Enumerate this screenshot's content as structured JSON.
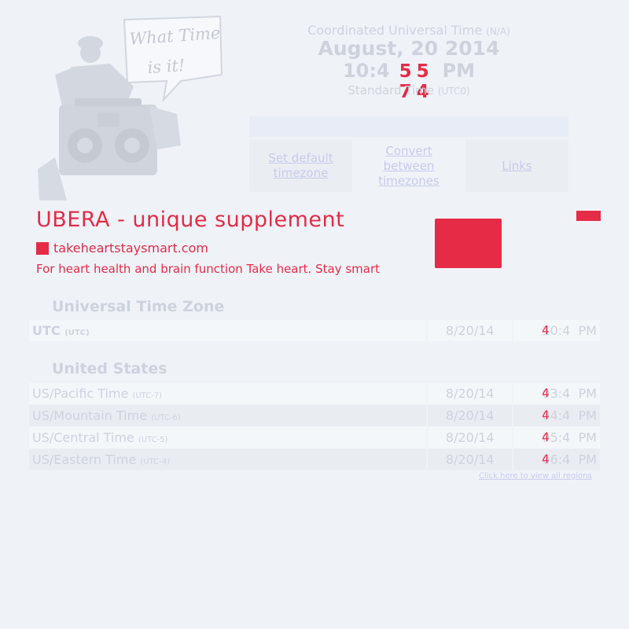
{
  "logo": {
    "speech_line1": "What Time",
    "speech_line2": "is it!"
  },
  "header": {
    "utc_label": "Coordinated Universal Time",
    "utc_tag": "(N/A)",
    "date": "August, 20 2014",
    "time_prefix": "10:4",
    "time_overlay": "5 5 7 4",
    "time_suffix": "PM",
    "std_label": "Standard Time",
    "std_tag": "(UTC0)"
  },
  "nav": {
    "set_default": "Set default timezone",
    "convert": "Convert between timezones",
    "links": "Links"
  },
  "ad": {
    "title": "UBERA - unique supplement",
    "url": "takeheartstaysmart.com",
    "desc": "For heart health and brain function Take heart. Stay smart"
  },
  "sections": {
    "utc_title": "Universal Time Zone",
    "us_title": "United States"
  },
  "rows": {
    "utc": {
      "name": "UTC",
      "tag": "(UTC)",
      "date": "8/20/14",
      "time": "10:4",
      "digit": "4",
      "ampm": "PM"
    },
    "pacific": {
      "name": "US/Pacific Time",
      "tag": "(UTC-7)",
      "date": "8/20/14",
      "time": "03:4",
      "digit": "4",
      "ampm": "PM"
    },
    "mountain": {
      "name": "US/Mountain Time",
      "tag": "(UTC-6)",
      "date": "8/20/14",
      "time": "04:4",
      "digit": "4",
      "ampm": "PM"
    },
    "central": {
      "name": "US/Central Time",
      "tag": "(UTC-5)",
      "date": "8/20/14",
      "time": "05:4",
      "digit": "4",
      "ampm": "PM"
    },
    "eastern": {
      "name": "US/Eastern Time",
      "tag": "(UTC-4)",
      "date": "8/20/14",
      "time": "06:4",
      "digit": "4",
      "ampm": "PM"
    }
  },
  "all_regions": "Click here to view all regions",
  "colors": {
    "accent": "#e62b46",
    "faded_text": "#cdd2dd",
    "link": "#c8c9ee",
    "background": "#eff3f8"
  }
}
